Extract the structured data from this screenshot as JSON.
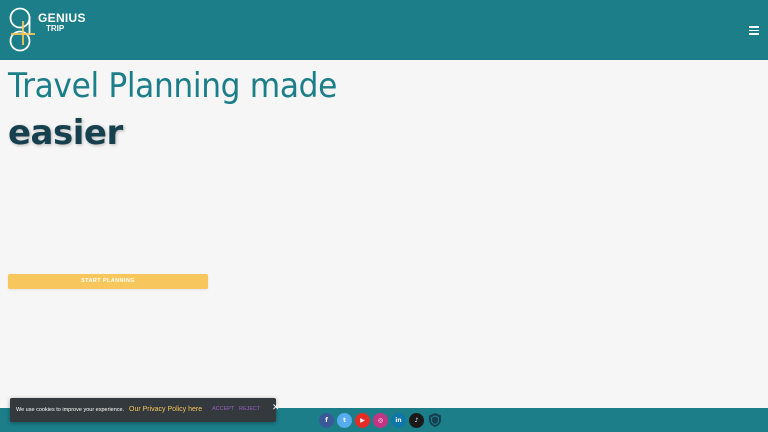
{
  "brand": {
    "line1": "GENIUS",
    "line2": "TRIP"
  },
  "header": {
    "menu_icon": "hamburger-menu-icon"
  },
  "hero": {
    "title_regular": "Travel Planning made",
    "title_bold": "easier",
    "cta_label": "START PLANNING"
  },
  "cookie_banner": {
    "text": "We use cookies to improve your experience.",
    "policy_link": "Our Privacy Policy here",
    "accept_label": "ACCEPT",
    "reject_label": "REJECT",
    "close_glyph": "✕"
  },
  "footer": {
    "social": [
      {
        "name": "facebook",
        "glyph": "f",
        "color": "#3b5998"
      },
      {
        "name": "twitter",
        "glyph": "t",
        "color": "#55acee"
      },
      {
        "name": "youtube",
        "glyph": "▶",
        "color": "#e52d27"
      },
      {
        "name": "instagram",
        "glyph": "◎",
        "color": "#c13584"
      },
      {
        "name": "linkedin",
        "glyph": "in",
        "color": "#0e76a8"
      },
      {
        "name": "tiktok",
        "glyph": "♪",
        "color": "#1a1a1a"
      }
    ]
  },
  "colors": {
    "header_bg": "#1b7e89",
    "accent_yellow": "#f7c65c",
    "title_teal": "#1b7e89",
    "title_dark": "#17404f",
    "page_bg": "#f6f6f6"
  }
}
